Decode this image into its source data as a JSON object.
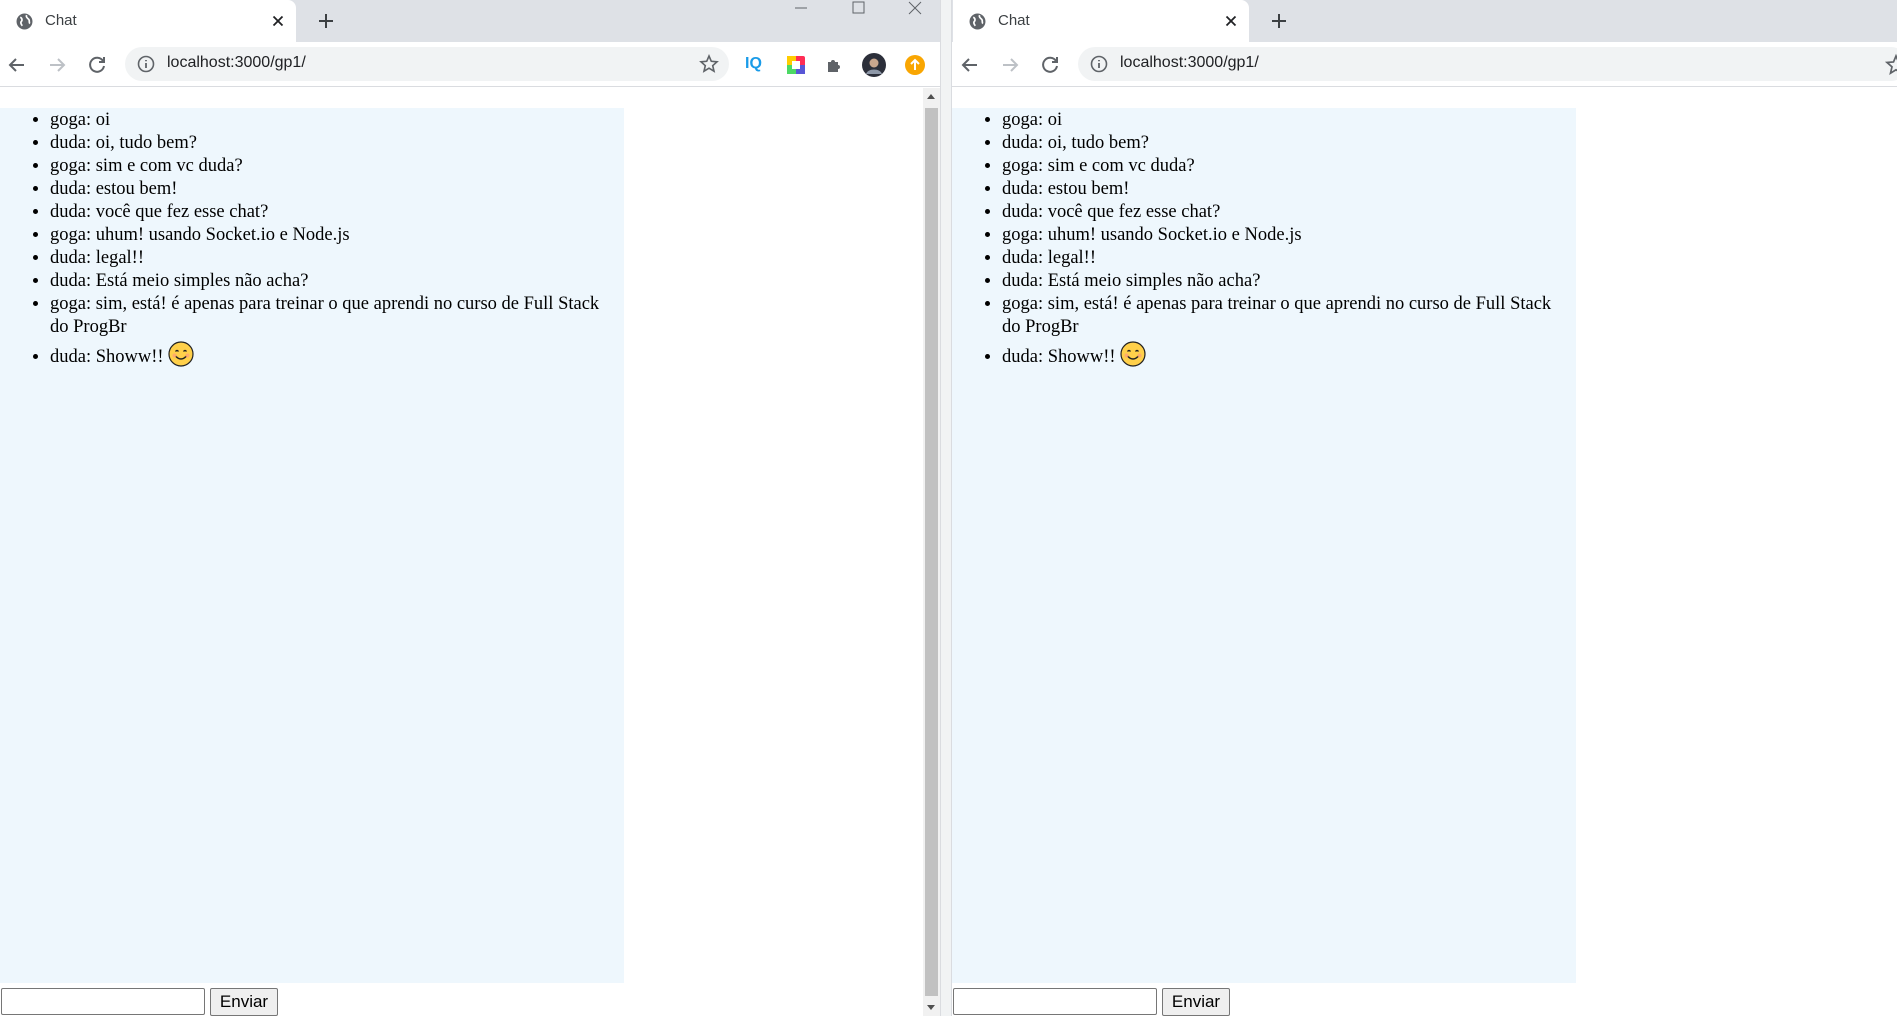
{
  "windows": [
    {
      "tab": {
        "title": "Chat",
        "favicon": "globe-icon"
      },
      "address": {
        "url": "localhost:3000/gp1/"
      },
      "messages": [
        {
          "text": "goga: oi"
        },
        {
          "text": "duda: oi, tudo bem?"
        },
        {
          "text": "goga: sim e com vc duda?"
        },
        {
          "text": "duda: estou bem!"
        },
        {
          "text": "duda: você que fez esse chat?"
        },
        {
          "text": "goga: uhum! usando Socket.io e Node.js"
        },
        {
          "text": "duda: legal!!"
        },
        {
          "text": "duda: Está meio simples não acha?"
        },
        {
          "text": "goga: sim, está! é apenas para treinar o que aprendi no curso de Full Stack do ProgBr"
        },
        {
          "text": "duda: Showw!!",
          "emoji": "smiling-face-icon"
        }
      ],
      "form": {
        "input_value": "",
        "send_label": "Enviar"
      },
      "extensions": [
        {
          "name": "iq-extension-icon",
          "label": "IQ",
          "color": "#1a9be8"
        },
        {
          "name": "color-picker-extension-icon"
        },
        {
          "name": "puzzle-icon"
        },
        {
          "name": "profile-avatar"
        },
        {
          "name": "update-icon",
          "color": "#f9a602"
        }
      ]
    },
    {
      "tab": {
        "title": "Chat",
        "favicon": "globe-icon"
      },
      "address": {
        "url": "localhost:3000/gp1/"
      },
      "messages": [
        {
          "text": "goga: oi"
        },
        {
          "text": "duda: oi, tudo bem?"
        },
        {
          "text": "goga: sim e com vc duda?"
        },
        {
          "text": "duda: estou bem!"
        },
        {
          "text": "duda: você que fez esse chat?"
        },
        {
          "text": "goga: uhum! usando Socket.io e Node.js"
        },
        {
          "text": "duda: legal!!"
        },
        {
          "text": "duda: Está meio simples não acha?"
        },
        {
          "text": "goga: sim, está! é apenas para treinar o que aprendi no curso de Full Stack do ProgBr"
        },
        {
          "text": "duda: Showw!!",
          "emoji": "smiling-face-icon"
        }
      ],
      "form": {
        "input_value": "",
        "send_label": "Enviar"
      }
    }
  ],
  "colors": {
    "messages_background": "#eef7fd",
    "tabstrip_background": "#dee1e6",
    "omnibox_background": "#f1f3f4"
  }
}
